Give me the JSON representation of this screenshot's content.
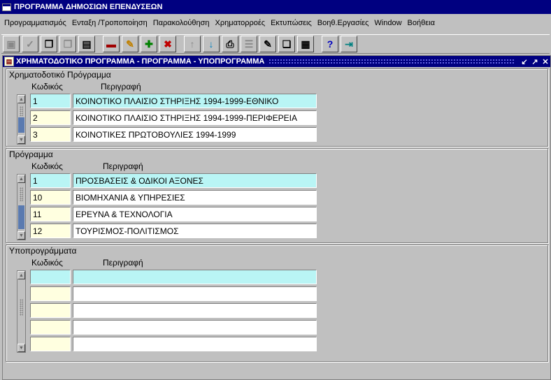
{
  "window": {
    "title": "ΠΡΟΓΡΑΜΜΑ ΔΗΜΟΣΙΩΝ ΕΠΕΝΔΥΣΕΩΝ"
  },
  "menu": [
    "Προγραμματισμός",
    "Ενταξη /Τροποποίηση",
    "Παρακολούθηση",
    "Χρηματορροές",
    "Εκτυπώσεις",
    "Βοηθ.Εργασίες",
    "Window",
    "Βοήθεια"
  ],
  "toolbar": [
    "save-icon",
    "accept-icon",
    "copy-icon",
    "copy-disabled-icon",
    "paste-record-icon",
    "enter-query-icon",
    "edit-icon",
    "insert-record-icon",
    "delete-record-icon",
    "up-icon",
    "down-icon",
    "print-icon",
    "list-icon",
    "edit-field-icon",
    "copy-text-icon",
    "paste-text-icon",
    "help-icon",
    "exit-icon"
  ],
  "form": {
    "title": "ΧΡΗΜΑΤΟΔΟΤΙΚΟ ΠΡΟΓΡΑΜΜΑ - ΠΡΟΓΡΑΜΜΑ - ΥΠΟΠΡΟΓΡΑΜΜΑ",
    "blocks": [
      {
        "title": "Χρηματοδοτικό Πρόγραμμα",
        "col_code": "Κωδικός",
        "col_desc": "Περιγραφή",
        "rows": [
          {
            "code": "1",
            "desc": "ΚΟΙΝΟΤΙΚΟ ΠΛΑΙΣΙΟ ΣΤΗΡΙΞΗΣ 1994-1999-ΕΘΝΙΚΟ"
          },
          {
            "code": "2",
            "desc": "ΚΟΙΝΟΤΙΚΟ ΠΛΑΙΣΙΟ ΣΤΗΡΙΞΗΣ 1994-1999-ΠΕΡΙΦΕΡΕΙΑ"
          },
          {
            "code": "3",
            "desc": "ΚΟΙΝΟΤΙΚΕΣ ΠΡΩΤΟΒΟΥΛΙΕΣ 1994-1999"
          }
        ]
      },
      {
        "title": "Πρόγραμμα",
        "col_code": "Κωδικός",
        "col_desc": "Περιγραφή",
        "rows": [
          {
            "code": "1",
            "desc": "ΠΡΟΣΒΑΣΕΙΣ & ΟΔΙΚΟΙ ΑΞΟΝΕΣ"
          },
          {
            "code": "10",
            "desc": "ΒΙΟΜΗΧΑΝΙΑ & ΥΠΗΡΕΣΙΕΣ"
          },
          {
            "code": "11",
            "desc": "ΕΡΕΥΝΑ & ΤΕΧΝΟΛΟΓΙΑ"
          },
          {
            "code": "12",
            "desc": "ΤΟΥΡΙΣΜΟΣ-ΠΟΛΙΤΙΣΜΟΣ"
          }
        ]
      },
      {
        "title": "Υποπρογράμματα",
        "col_code": "Κωδικός",
        "col_desc": "Περιγραφή",
        "rows": [
          {
            "code": "",
            "desc": ""
          },
          {
            "code": "",
            "desc": ""
          },
          {
            "code": "",
            "desc": ""
          },
          {
            "code": "",
            "desc": ""
          },
          {
            "code": "",
            "desc": ""
          }
        ]
      }
    ]
  }
}
